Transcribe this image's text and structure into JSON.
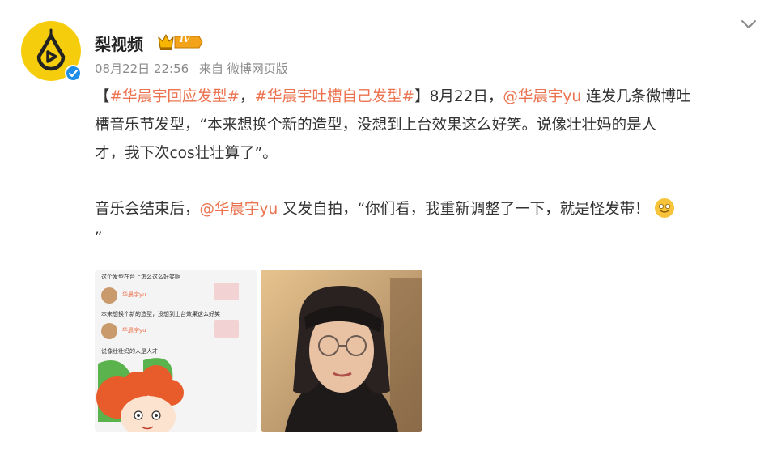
{
  "account": {
    "name": "梨视频",
    "badge": "IV",
    "date": "08月22日 22:56",
    "source": "来自 微博网页版",
    "avatar_icon": "pear-video-logo-icon",
    "verified_icon": "verified-badge-icon"
  },
  "post": {
    "line1": {
      "open": "【",
      "topic1": "#华晨宇回应发型#",
      "sep": "，",
      "topic2": "#华晨宇吐槽自己发型#",
      "close_date": "】8月22日，",
      "mention": "@华晨宇yu",
      "tail": " 连发几条微博吐"
    },
    "line2": "槽音乐节发型，“本来想换个新的造型，没想到上台效果这么好笑。说像壮壮妈的是人",
    "line3": "才，我下次cos壮壮算了”。",
    "line4": {
      "head": "音乐会结束后，",
      "mention": "@华晨宇yu",
      "tail": " 又发自拍，“你们看，我重新调整了一下，就是怪发带！"
    },
    "line5": "”"
  },
  "images": {
    "screenshot": {
      "caption": "这个发型在台上怎么这么好笑啊",
      "name1": "华晨宇yu",
      "text1": "本来想换个新的造型，没想到上台效果这么好笑",
      "name2": "华晨宇yu",
      "text2": "说像壮壮妈的人是人才"
    },
    "selfie": {
      "icon": "selfie-photo"
    }
  },
  "colors": {
    "accent": "#eb7350",
    "avatar_bg": "#f5cd0c",
    "verified": "#1e8ee8",
    "meta": "#8a8a8a"
  }
}
